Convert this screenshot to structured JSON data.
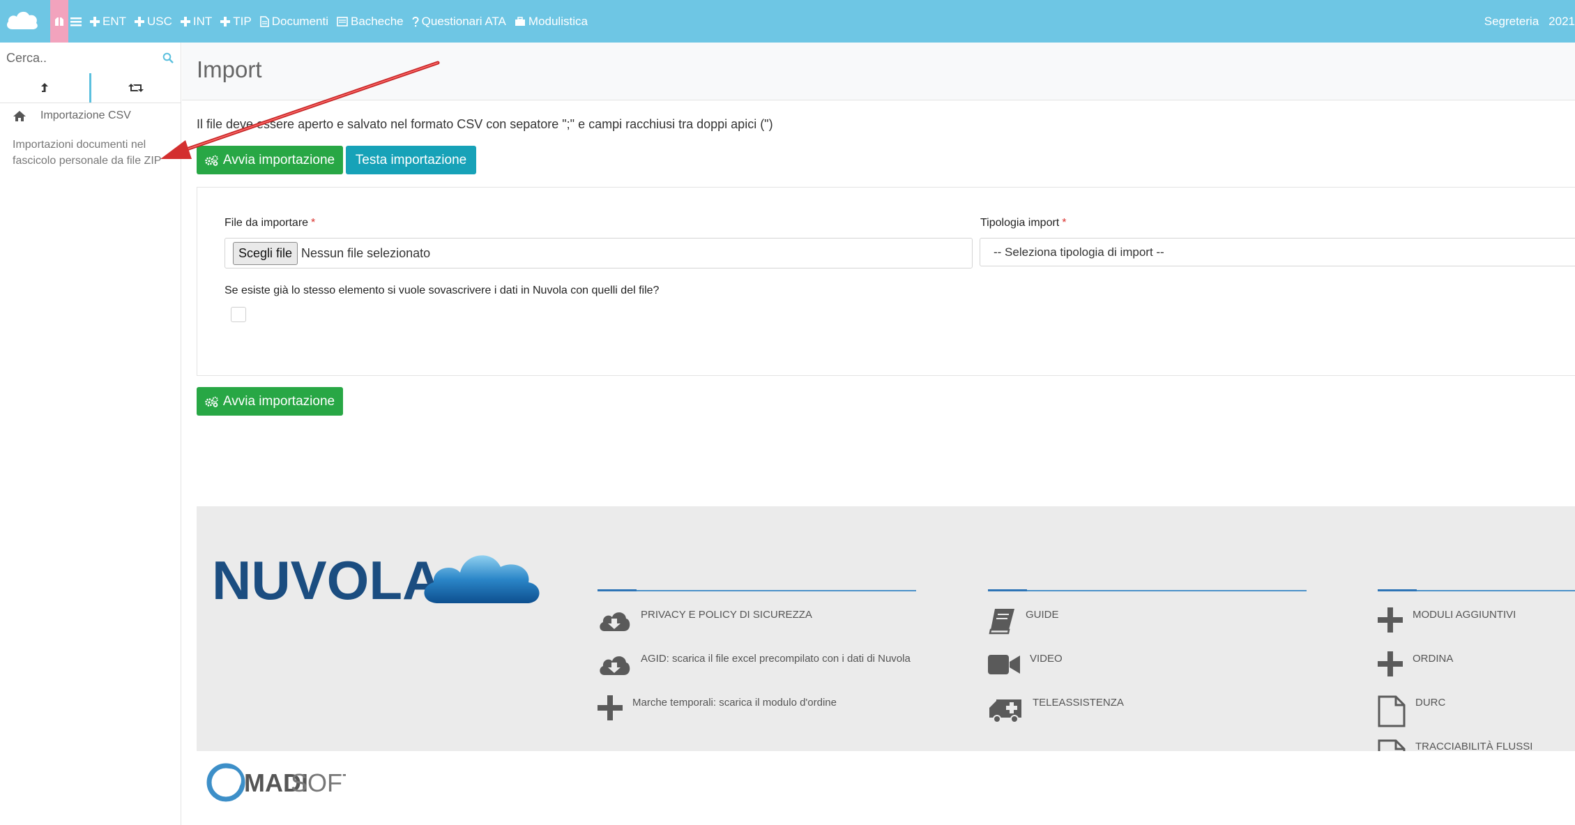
{
  "topbar": {
    "nav": [
      {
        "label": "ENT",
        "icon": "plus-icon"
      },
      {
        "label": "USC",
        "icon": "plus-icon"
      },
      {
        "label": "INT",
        "icon": "plus-icon"
      },
      {
        "label": "TIP",
        "icon": "plus-icon"
      },
      {
        "label": "Documenti",
        "icon": "document-icon"
      },
      {
        "label": "Bacheche",
        "icon": "board-icon"
      },
      {
        "label": "Questionari ATA",
        "icon": "question-icon"
      },
      {
        "label": "Modulistica",
        "icon": "briefcase-icon"
      }
    ],
    "right_label": "Segreteria",
    "year": "2021",
    "colors": {
      "bar": "#6ec6e4",
      "home": "#f2a3bd"
    }
  },
  "sidebar": {
    "search_placeholder": "Cerca..",
    "items": [
      {
        "label": "Importazione CSV"
      },
      {
        "label": "Importazioni documenti nel fascicolo personale da file ZIP"
      }
    ]
  },
  "main": {
    "title": "Import",
    "info": "Il file deve essere aperto e salvato nel formato CSV con sepatore \";\" e campi racchiusi tra doppi apici (\")",
    "start_button": "Avvia importazione",
    "test_button": "Testa importazione",
    "form": {
      "file_label": "File da importare",
      "required_mark": "*",
      "choose_file": "Scegli file",
      "no_file": "Nessun file selezionato",
      "type_label": "Tipologia import",
      "type_placeholder": "-- Seleziona tipologia di import --",
      "overwrite_question": "Se esiste già lo stesso elemento si vuole sovascrivere i dati in Nuvola con quelli del file?"
    },
    "bottom_button": "Avvia importazione"
  },
  "footer": {
    "brand": "NUVOLA",
    "col1": [
      {
        "label": "PRIVACY E POLICY DI SICUREZZA",
        "icon": "cloud-download-icon"
      },
      {
        "label": "AGID: scarica il file excel precompilato con i dati di Nuvola",
        "icon": "cloud-download-icon"
      },
      {
        "label": "Marche temporali: scarica il modulo d'ordine",
        "icon": "plus-icon"
      }
    ],
    "col2": [
      {
        "label": "GUIDE",
        "icon": "book-icon"
      },
      {
        "label": "VIDEO",
        "icon": "video-camera-icon"
      },
      {
        "label": "TELEASSISTENZA",
        "icon": "ambulance-icon"
      }
    ],
    "col3": [
      {
        "label": "MODULI AGGIUNTIVI",
        "icon": "plus-icon"
      },
      {
        "label": "ORDINA",
        "icon": "plus-icon"
      },
      {
        "label": "DURC",
        "icon": "file-icon"
      },
      {
        "label": "TRACCIABILITÀ FLUSSI",
        "icon": "file-icon"
      }
    ],
    "company_a": "MADI",
    "company_b": "SOFT"
  }
}
